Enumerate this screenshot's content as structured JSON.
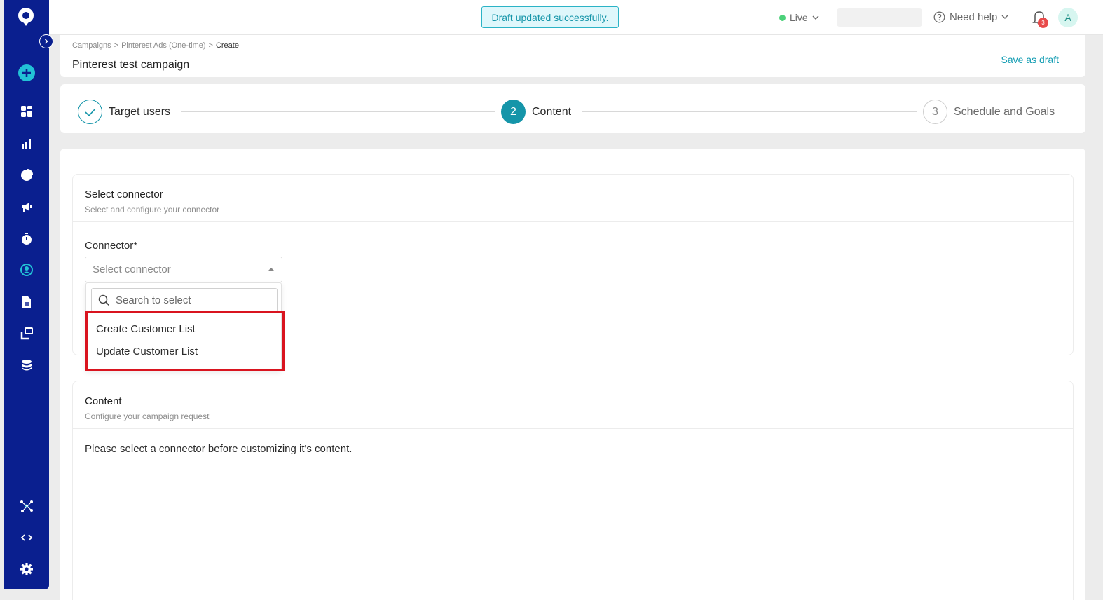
{
  "topbar": {
    "toast": "Draft updated successfully.",
    "environment": "Live",
    "help": "Need help",
    "notification_count": "3",
    "avatar_initial": "A"
  },
  "header": {
    "breadcrumb": [
      "Campaigns",
      ">",
      "Pinterest Ads (One-time)",
      ">",
      "Create"
    ],
    "title": "Pinterest test campaign",
    "save_draft": "Save as draft"
  },
  "stepper": {
    "steps": [
      {
        "number": "1",
        "label": "Target users",
        "state": "done"
      },
      {
        "number": "2",
        "label": "Content",
        "state": "active"
      },
      {
        "number": "3",
        "label": "Schedule and Goals",
        "state": "todo"
      }
    ]
  },
  "connector_section": {
    "title": "Select connector",
    "subtitle": "Select and configure your connector",
    "field_label": "Connector*",
    "select_placeholder": "Select connector",
    "search_placeholder": "Search to select",
    "options": [
      "Create Customer List",
      "Update Customer List"
    ]
  },
  "content_section": {
    "title": "Content",
    "subtitle": "Configure your campaign request",
    "message": "Please select a connector before customizing it's content."
  },
  "colors": {
    "sidebar": "#0a1f8f",
    "accent": "#1595a9",
    "highlight": "#d9141f",
    "live": "#4cd17a"
  }
}
